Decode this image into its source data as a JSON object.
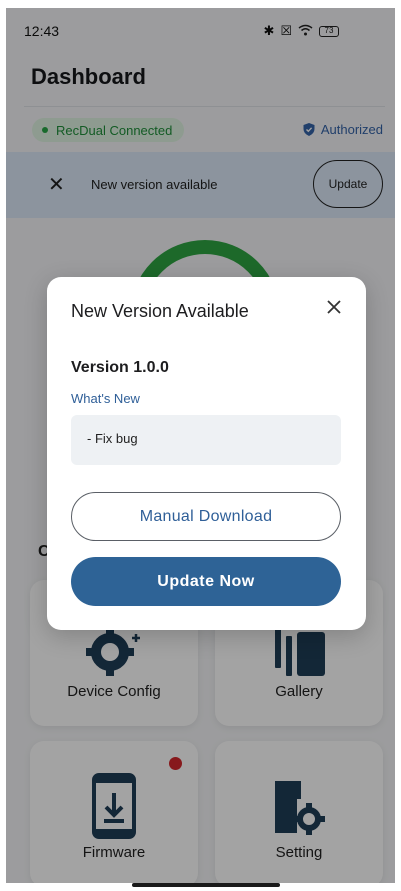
{
  "status_bar": {
    "time": "12:43",
    "battery": "73",
    "icons": [
      "bluetooth-icon",
      "no-sim-icon",
      "wifi-icon",
      "battery-icon"
    ]
  },
  "header": {
    "title": "Dashboard"
  },
  "connection": {
    "label": "RecDual Connected",
    "color": "#27a646"
  },
  "authorization": {
    "label": "Authorized",
    "icon": "shield-check-icon"
  },
  "banner": {
    "message": "New version available",
    "update_label": "Update",
    "close_icon": "close-icon"
  },
  "section_partial_label": "C",
  "tiles": [
    {
      "label": "Device Config",
      "icon": "gear-icon"
    },
    {
      "label": "Gallery",
      "icon": "gallery-icon"
    },
    {
      "label": "Firmware",
      "icon": "phone-download-icon",
      "has_notification": true
    },
    {
      "label": "Setting",
      "icon": "door-settings-icon"
    }
  ],
  "dialog": {
    "title": "New Version Available",
    "version": "Version 1.0.0",
    "whats_new_label": "What's New",
    "notes": "- Fix bug",
    "manual_download_label": "Manual Download",
    "update_now_label": "Update Now",
    "accent_color": "#2e6396"
  }
}
